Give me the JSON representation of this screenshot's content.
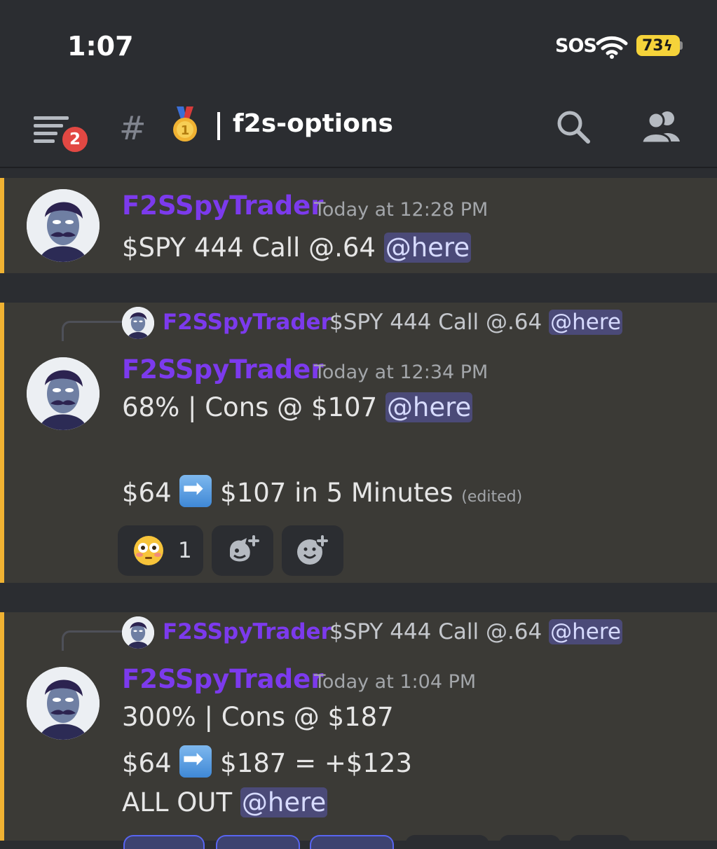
{
  "status_bar": {
    "time": "1:07",
    "carrier_status": "SOS",
    "battery": "73",
    "battery_color": "#f5d33a"
  },
  "header": {
    "notification_count": "2",
    "hash": "#",
    "medal_icon": "medal-icon",
    "channel_name": "f2s-options",
    "accent_color": "#f0b232"
  },
  "messages": [
    {
      "author": "F2SSpyTrader",
      "timestamp": "Today at 12:28 PM",
      "line1": "$SPY 444 Call @.64",
      "mention": "@here"
    },
    {
      "reply": {
        "author": "F2SSpyTrader",
        "text": "$SPY 444 Call @.64",
        "mention": "@here"
      },
      "author": "F2SSpyTrader",
      "timestamp": "Today at 12:34 PM",
      "line1": "68% | Cons @ $107",
      "mention": "@here",
      "line2_a": "$64",
      "line2_b": "$107 in 5 Minutes",
      "edited": "(edited)",
      "reactions": [
        {
          "emoji": "flushed-face",
          "count": "1"
        },
        {
          "emoji": "add-super-reaction-icon"
        },
        {
          "emoji": "add-reaction-icon"
        }
      ]
    },
    {
      "reply": {
        "author": "F2SSpyTrader",
        "text": "$SPY 444 Call @.64",
        "mention": "@here"
      },
      "author": "F2SSpyTrader",
      "timestamp": "Today at 1:04 PM",
      "line1": "300% | Cons @ $187",
      "line2_a": "$64",
      "line2_b": "$187 = +$123",
      "line3": "ALL OUT",
      "mention": "@here"
    }
  ],
  "colors": {
    "username": "#7c3aed",
    "mention_bg": "#4b4a78",
    "message_bg": "#3b3a36",
    "background": "#2b2d31"
  }
}
